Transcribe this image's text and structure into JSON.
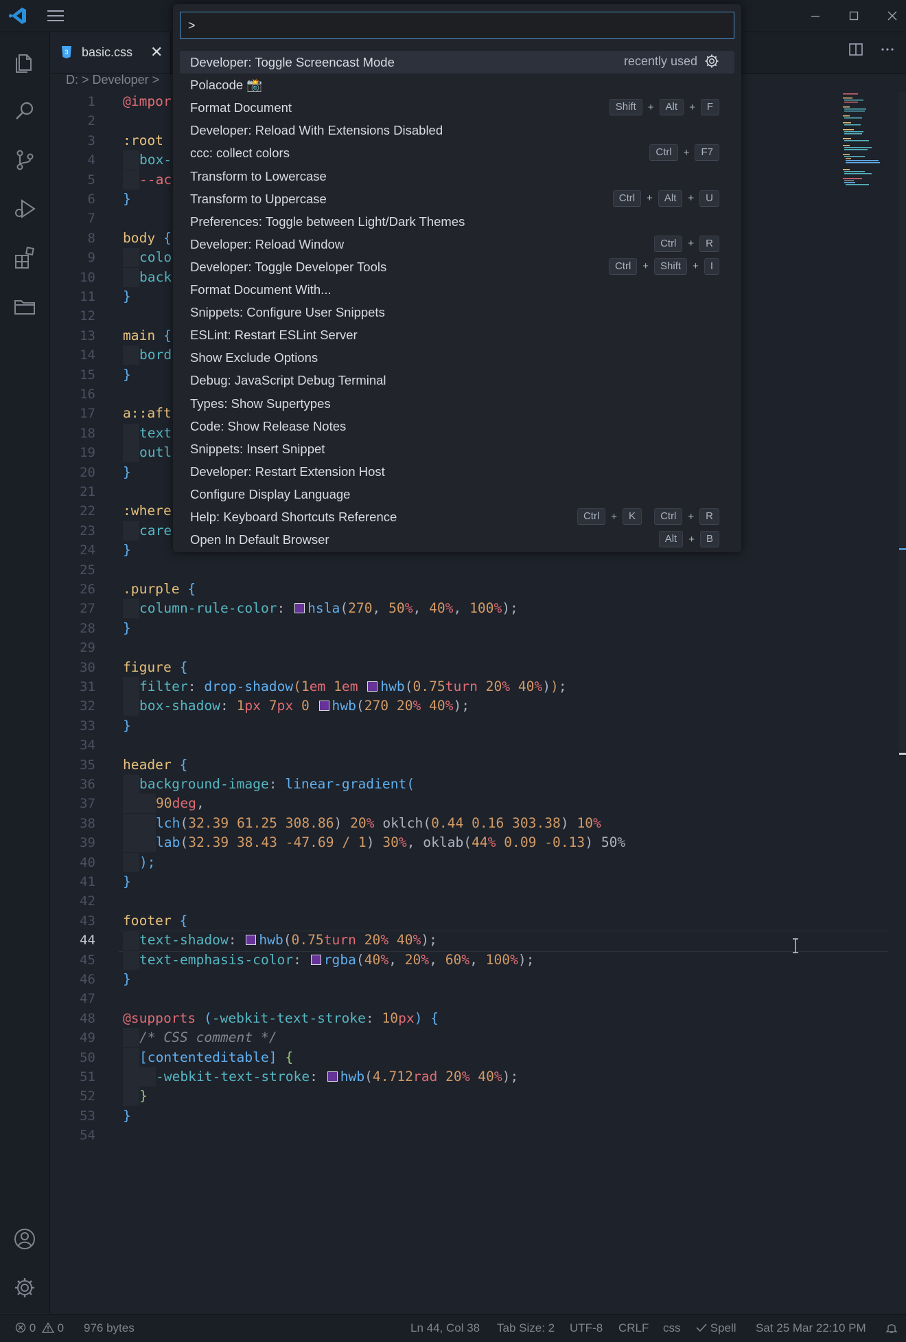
{
  "editor_tab": {
    "label": "basic.css",
    "close_glyph": "✕",
    "icon": "css3-icon"
  },
  "breadcrumb": {
    "drive": "D:",
    "sep": ">",
    "folder": "Developer",
    "more": ">"
  },
  "command_palette": {
    "value": ">",
    "items": [
      {
        "label": "Developer: Toggle Screencast Mode",
        "note": "recently used",
        "gear": "gear-icon"
      },
      {
        "label": "Polacode 📸"
      },
      {
        "label": "Format Document",
        "keys": [
          "Shift",
          "+",
          "Alt",
          "+",
          "F"
        ]
      },
      {
        "label": "Developer: Reload With Extensions Disabled"
      },
      {
        "label": "ccc: collect colors",
        "keys": [
          "Ctrl",
          "+",
          "F7"
        ]
      },
      {
        "label": "Transform to Lowercase"
      },
      {
        "label": "Transform to Uppercase",
        "keys": [
          "Ctrl",
          "+",
          "Alt",
          "+",
          "U"
        ]
      },
      {
        "label": "Preferences: Toggle between Light/Dark Themes"
      },
      {
        "label": "Developer: Reload Window",
        "keys": [
          "Ctrl",
          "+",
          "R"
        ]
      },
      {
        "label": "Developer: Toggle Developer Tools",
        "keys": [
          "Ctrl",
          "+",
          "Shift",
          "+",
          "I"
        ]
      },
      {
        "label": "Format Document With..."
      },
      {
        "label": "Snippets: Configure User Snippets"
      },
      {
        "label": "ESLint: Restart ESLint Server"
      },
      {
        "label": "Show Exclude Options"
      },
      {
        "label": "Debug: JavaScript Debug Terminal"
      },
      {
        "label": "Types: Show Supertypes"
      },
      {
        "label": "Code: Show Release Notes"
      },
      {
        "label": "Snippets: Insert Snippet"
      },
      {
        "label": "Developer: Restart Extension Host"
      },
      {
        "label": "Configure Display Language"
      },
      {
        "label": "Help: Keyboard Shortcuts Reference",
        "keys": [
          "Ctrl",
          "+",
          "K",
          " ",
          "Ctrl",
          "+",
          "R"
        ]
      },
      {
        "label": "Open In Default Browser",
        "keys": [
          "Alt",
          "+",
          "B"
        ]
      }
    ]
  },
  "code": {
    "active_line": 44,
    "lines": [
      {
        "n": 1,
        "t": [
          [
            "@impor",
            "k"
          ]
        ]
      },
      {
        "n": 2,
        "t": []
      },
      {
        "n": 3,
        "t": [
          [
            ":root ",
            "sel"
          ]
        ]
      },
      {
        "n": 4,
        "t": [
          [
            "IND",
            ""
          ],
          [
            "box-",
            "prop"
          ]
        ]
      },
      {
        "n": 5,
        "t": [
          [
            "IND",
            ""
          ],
          [
            "--ac",
            "var"
          ]
        ]
      },
      {
        "n": 6,
        "t": [
          [
            "}",
            "brace"
          ]
        ]
      },
      {
        "n": 7,
        "t": []
      },
      {
        "n": 8,
        "t": [
          [
            "body ",
            "sel"
          ],
          [
            "{",
            "brace"
          ]
        ]
      },
      {
        "n": 9,
        "t": [
          [
            "IND",
            ""
          ],
          [
            "colo",
            "prop"
          ]
        ]
      },
      {
        "n": 10,
        "t": [
          [
            "IND",
            ""
          ],
          [
            "back",
            "prop"
          ]
        ]
      },
      {
        "n": 11,
        "t": [
          [
            "}",
            "brace"
          ]
        ]
      },
      {
        "n": 12,
        "t": []
      },
      {
        "n": 13,
        "t": [
          [
            "main ",
            "sel"
          ],
          [
            "{",
            "brace"
          ]
        ]
      },
      {
        "n": 14,
        "t": [
          [
            "IND",
            ""
          ],
          [
            "bord",
            "prop"
          ]
        ]
      },
      {
        "n": 15,
        "t": [
          [
            "}",
            "brace"
          ]
        ]
      },
      {
        "n": 16,
        "t": []
      },
      {
        "n": 17,
        "t": [
          [
            "a::aft",
            "sel"
          ]
        ]
      },
      {
        "n": 18,
        "t": [
          [
            "IND",
            ""
          ],
          [
            "text",
            "prop"
          ]
        ]
      },
      {
        "n": 19,
        "t": [
          [
            "IND",
            ""
          ],
          [
            "outl",
            "prop"
          ]
        ]
      },
      {
        "n": 20,
        "t": [
          [
            "}",
            "brace"
          ]
        ]
      },
      {
        "n": 21,
        "t": []
      },
      {
        "n": 22,
        "t": [
          [
            ":where",
            "sel"
          ]
        ]
      },
      {
        "n": 23,
        "t": [
          [
            "IND",
            ""
          ],
          [
            "care",
            "prop"
          ]
        ]
      },
      {
        "n": 24,
        "t": [
          [
            "}",
            "brace"
          ]
        ]
      },
      {
        "n": 25,
        "t": []
      },
      {
        "n": 26,
        "t": [
          [
            ".purple ",
            "sel"
          ],
          [
            "{",
            "brace"
          ]
        ]
      },
      {
        "n": 27,
        "t": [
          [
            "IND",
            ""
          ],
          [
            "column-rule-color",
            "prop"
          ],
          [
            ": ",
            "punc"
          ],
          [
            "SW",
            ""
          ],
          [
            "hsla",
            "fn"
          ],
          [
            "(",
            "punc"
          ],
          [
            "270",
            "num"
          ],
          [
            ", ",
            "punc"
          ],
          [
            "50",
            "num"
          ],
          [
            "%",
            "unit"
          ],
          [
            ", ",
            "punc"
          ],
          [
            "40",
            "num"
          ],
          [
            "%",
            "unit"
          ],
          [
            ", ",
            "punc"
          ],
          [
            "100",
            "num"
          ],
          [
            "%",
            "unit"
          ],
          [
            ");",
            "punc"
          ]
        ]
      },
      {
        "n": 28,
        "t": [
          [
            "}",
            "brace"
          ]
        ]
      },
      {
        "n": 29,
        "t": []
      },
      {
        "n": 30,
        "t": [
          [
            "figure ",
            "sel"
          ],
          [
            "{",
            "brace"
          ]
        ]
      },
      {
        "n": 31,
        "t": [
          [
            "IND",
            ""
          ],
          [
            "filter",
            "prop"
          ],
          [
            ": ",
            "punc"
          ],
          [
            "drop-shadow",
            "fn"
          ],
          [
            "(",
            "num"
          ],
          [
            "1",
            "num"
          ],
          [
            "em ",
            "unit"
          ],
          [
            "1",
            "num"
          ],
          [
            "em ",
            "unit"
          ],
          [
            "SW",
            ""
          ],
          [
            "hwb",
            "fn"
          ],
          [
            "(",
            "punc"
          ],
          [
            "0.75",
            "num"
          ],
          [
            "turn ",
            "unit"
          ],
          [
            "20",
            "num"
          ],
          [
            "% ",
            "unit"
          ],
          [
            "40",
            "num"
          ],
          [
            "%",
            "unit"
          ],
          [
            ")",
            "punc"
          ],
          [
            ")",
            "num"
          ],
          [
            ";",
            "punc"
          ]
        ]
      },
      {
        "n": 32,
        "t": [
          [
            "IND",
            ""
          ],
          [
            "box-shadow",
            "prop"
          ],
          [
            ": ",
            "punc"
          ],
          [
            "1",
            "num"
          ],
          [
            "px ",
            "unit"
          ],
          [
            "7",
            "num"
          ],
          [
            "px ",
            "unit"
          ],
          [
            "0 ",
            "num"
          ],
          [
            "SW",
            ""
          ],
          [
            "hwb",
            "fn"
          ],
          [
            "(",
            "punc"
          ],
          [
            "270 ",
            "num"
          ],
          [
            "20",
            "num"
          ],
          [
            "% ",
            "unit"
          ],
          [
            "40",
            "num"
          ],
          [
            "%",
            "unit"
          ],
          [
            ");",
            "punc"
          ]
        ]
      },
      {
        "n": 33,
        "t": [
          [
            "}",
            "brace"
          ]
        ]
      },
      {
        "n": 34,
        "t": []
      },
      {
        "n": 35,
        "t": [
          [
            "header ",
            "sel"
          ],
          [
            "{",
            "brace"
          ]
        ]
      },
      {
        "n": 36,
        "t": [
          [
            "IND",
            ""
          ],
          [
            "background-image",
            "prop"
          ],
          [
            ": ",
            "punc"
          ],
          [
            "linear-gradient",
            "fn"
          ],
          [
            "(",
            "brace"
          ]
        ]
      },
      {
        "n": 37,
        "t": [
          [
            "IND",
            ""
          ],
          [
            "IND",
            ""
          ],
          [
            "90",
            "num"
          ],
          [
            "deg",
            "unit"
          ],
          [
            ",",
            "punc"
          ]
        ]
      },
      {
        "n": 38,
        "t": [
          [
            "IND",
            ""
          ],
          [
            "IND",
            ""
          ],
          [
            "lch",
            "fn"
          ],
          [
            "(",
            "punc"
          ],
          [
            "32.39 61.25 308.86",
            "num"
          ],
          [
            ") ",
            "punc"
          ],
          [
            "20",
            "num"
          ],
          [
            "% ",
            "unit"
          ],
          [
            "oklch",
            "punc"
          ],
          [
            "(",
            "punc"
          ],
          [
            "0.44 0.16 303.38",
            "num"
          ],
          [
            ") ",
            "punc"
          ],
          [
            "10",
            "num"
          ],
          [
            "%",
            "unit"
          ]
        ]
      },
      {
        "n": 39,
        "t": [
          [
            "IND",
            ""
          ],
          [
            "IND",
            ""
          ],
          [
            "lab",
            "fn"
          ],
          [
            "(",
            "punc"
          ],
          [
            "32.39 38.43 -47.69 / 1",
            "num"
          ],
          [
            ") ",
            "punc"
          ],
          [
            "30",
            "num"
          ],
          [
            "%",
            "unit"
          ],
          [
            ", oklab(",
            "punc"
          ],
          [
            "44",
            "num"
          ],
          [
            "% ",
            "unit"
          ],
          [
            "0.09 -0.13",
            "num"
          ],
          [
            ") 50%",
            "punc"
          ]
        ]
      },
      {
        "n": 40,
        "t": [
          [
            "IND",
            ""
          ],
          [
            ");",
            "brace"
          ]
        ]
      },
      {
        "n": 41,
        "t": [
          [
            "}",
            "brace"
          ]
        ]
      },
      {
        "n": 42,
        "t": []
      },
      {
        "n": 43,
        "t": [
          [
            "footer ",
            "sel"
          ],
          [
            "{",
            "brace"
          ]
        ]
      },
      {
        "n": 44,
        "t": [
          [
            "IND",
            ""
          ],
          [
            "text-shadow",
            "prop"
          ],
          [
            ": ",
            "punc"
          ],
          [
            "SW",
            ""
          ],
          [
            "hwb",
            "fn"
          ],
          [
            "(",
            "punc"
          ],
          [
            "0.75",
            "num"
          ],
          [
            "turn ",
            "unit"
          ],
          [
            "20",
            "num"
          ],
          [
            "% ",
            "unit"
          ],
          [
            "40",
            "num"
          ],
          [
            "%",
            "unit"
          ],
          [
            ");",
            "punc"
          ]
        ]
      },
      {
        "n": 45,
        "t": [
          [
            "IND",
            ""
          ],
          [
            "text-emphasis-color",
            "prop"
          ],
          [
            ": ",
            "punc"
          ],
          [
            "SW",
            ""
          ],
          [
            "rgba",
            "fn"
          ],
          [
            "(",
            "punc"
          ],
          [
            "40",
            "num"
          ],
          [
            "%",
            "unit"
          ],
          [
            ", ",
            "punc"
          ],
          [
            "20",
            "num"
          ],
          [
            "%",
            "unit"
          ],
          [
            ", ",
            "punc"
          ],
          [
            "60",
            "num"
          ],
          [
            "%",
            "unit"
          ],
          [
            ", ",
            "punc"
          ],
          [
            "100",
            "num"
          ],
          [
            "%",
            "unit"
          ],
          [
            ");",
            "punc"
          ]
        ]
      },
      {
        "n": 46,
        "t": [
          [
            "}",
            "brace"
          ]
        ]
      },
      {
        "n": 47,
        "t": []
      },
      {
        "n": 48,
        "t": [
          [
            "@supports ",
            "k"
          ],
          [
            "(",
            "brace"
          ],
          [
            "-webkit-text-stroke",
            "prop"
          ],
          [
            ": ",
            "punc"
          ],
          [
            "10",
            "num"
          ],
          [
            "px",
            "unit"
          ],
          [
            ") ",
            "brace"
          ],
          [
            "{",
            "brace"
          ]
        ]
      },
      {
        "n": 49,
        "t": [
          [
            "IND",
            ""
          ],
          [
            "/* CSS comment */",
            "cmt"
          ]
        ]
      },
      {
        "n": 50,
        "t": [
          [
            "IND",
            ""
          ],
          [
            "[contenteditable] ",
            "fn"
          ],
          [
            "{",
            "brace2"
          ]
        ]
      },
      {
        "n": 51,
        "t": [
          [
            "IND",
            ""
          ],
          [
            "IND",
            ""
          ],
          [
            "-webkit-text-stroke",
            "prop"
          ],
          [
            ": ",
            "punc"
          ],
          [
            "SW",
            ""
          ],
          [
            "hwb",
            "fn"
          ],
          [
            "(",
            "punc"
          ],
          [
            "4.712",
            "num"
          ],
          [
            "rad ",
            "unit"
          ],
          [
            "20",
            "num"
          ],
          [
            "% ",
            "unit"
          ],
          [
            "40",
            "num"
          ],
          [
            "%",
            "unit"
          ],
          [
            ");",
            "punc"
          ]
        ]
      },
      {
        "n": 52,
        "t": [
          [
            "IND",
            ""
          ],
          [
            "}",
            "brace2"
          ]
        ]
      },
      {
        "n": 53,
        "t": [
          [
            "}",
            "brace"
          ]
        ]
      },
      {
        "n": 54,
        "t": []
      }
    ]
  },
  "statusbar": {
    "errors": "0",
    "warnings": "0",
    "size": "976 bytes",
    "position": "Ln 44, Col 38",
    "tab_size": "Tab Size: 2",
    "encoding": "UTF-8",
    "eol": "CRLF",
    "language": "css",
    "spell": "Spell",
    "datetime": "Sat 25 Mar 22:10 PM"
  },
  "colors": {
    "accent": "#4e94ce",
    "background": "#1e222a",
    "swatch": "#663399"
  }
}
